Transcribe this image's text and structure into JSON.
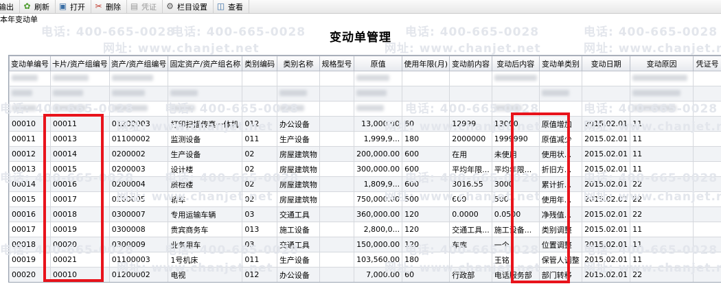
{
  "toolbar": {
    "items": [
      {
        "label": "输出",
        "icon": "export-icon",
        "disabled": false
      },
      {
        "label": "刷新",
        "icon": "refresh-icon",
        "disabled": false
      },
      {
        "label": "打开",
        "icon": "open-icon",
        "disabled": false
      },
      {
        "label": "删除",
        "icon": "delete-icon",
        "disabled": false
      },
      {
        "label": "凭证",
        "icon": "voucher-icon",
        "disabled": true
      },
      {
        "label": "栏目设置",
        "icon": "gear-icon",
        "disabled": false
      },
      {
        "label": "查看",
        "icon": "view-icon",
        "disabled": false
      }
    ]
  },
  "tab_label": "本年变动单",
  "title": "变动单管理",
  "watermark_text": [
    "电话: 400-665-0028",
    "网址: www.chanjet.net"
  ],
  "columns": [
    "变动单编号",
    "卡片/资产组编号",
    "资产/资产组编号",
    "固定资产/资产组名称",
    "类别编码",
    "类别名称",
    "规格型号",
    "原值",
    "使用年限(月)",
    "变动前内容",
    "变动后内容",
    "变动单类别",
    "变动日期",
    "变动原因",
    "凭证号"
  ],
  "rows": [
    [
      "00010",
      "00011",
      "01200003",
      "打印扫描传真一体机",
      "012",
      "办公设备",
      "",
      "13,000.00",
      "60",
      "12999",
      "13000",
      "原值增加",
      "2015.02.01",
      "11",
      ""
    ],
    [
      "00011",
      "00013",
      "01100002",
      "监测设备",
      "011",
      "生产设备",
      "",
      "1,999,9...",
      "180",
      "2000000",
      "1999990",
      "原值减少",
      "2015.02.01",
      "11",
      ""
    ],
    [
      "00012",
      "00014",
      "0200002",
      "生产设备",
      "02",
      "房屋建筑物",
      "",
      "200,000.00",
      "600",
      "在用",
      "未使用",
      "使用状...",
      "2015.02.01",
      "11",
      ""
    ],
    [
      "00013",
      "00015",
      "0200003",
      "设计楼",
      "02",
      "房屋建筑物",
      "",
      "300,000.00",
      "600",
      "平均年限...",
      "平均年限...",
      "折旧方...",
      "2015.02.01",
      "11",
      ""
    ],
    [
      "00014",
      "00016",
      "0200004",
      "质检楼",
      "02",
      "房屋建筑物",
      "",
      "1,809,9...",
      "600",
      "3016.55",
      "3000",
      "累计折...",
      "2015.02.01",
      "22",
      ""
    ],
    [
      "00015",
      "00017",
      "0200005",
      "轿车",
      "02",
      "房屋建筑物",
      "",
      "750,000.00",
      "500",
      "600",
      "500",
      "使用年...",
      "2015.02.01",
      "22",
      ""
    ],
    [
      "00016",
      "00018",
      "0300007",
      "专用运输车辆",
      "03",
      "交通工具",
      "",
      "360,000.00",
      "120",
      "0.0000",
      "0.0500",
      "净残值...",
      "2015.02.01",
      "22",
      ""
    ],
    [
      "00017",
      "00019",
      "0300008",
      "贵宾商务车",
      "013",
      "施工设备",
      "",
      "2,800,0...",
      "120",
      "交通工具...",
      "施工设备...",
      "类别调整",
      "2015.02.01",
      "11",
      ""
    ],
    [
      "00018",
      "00020",
      "0300009",
      "业务用车",
      "03",
      "交通工具",
      "",
      "150,000.00",
      "120",
      "车库",
      "一个",
      "位置调整",
      "2015.02.01",
      "11",
      ""
    ],
    [
      "00019",
      "00021",
      "01100003",
      "1号机床",
      "011",
      "生产设备",
      "",
      "103,560.00",
      "180",
      "",
      "王铭",
      "保管人调整",
      "2015.02.01",
      "11",
      ""
    ],
    [
      "00020",
      "00010",
      "01200002",
      "电视",
      "012",
      "办公设备",
      "",
      "7,000.00",
      "60",
      "行政部",
      "电话服务部",
      "部门转移",
      "2015.02.01",
      "22",
      ""
    ]
  ]
}
